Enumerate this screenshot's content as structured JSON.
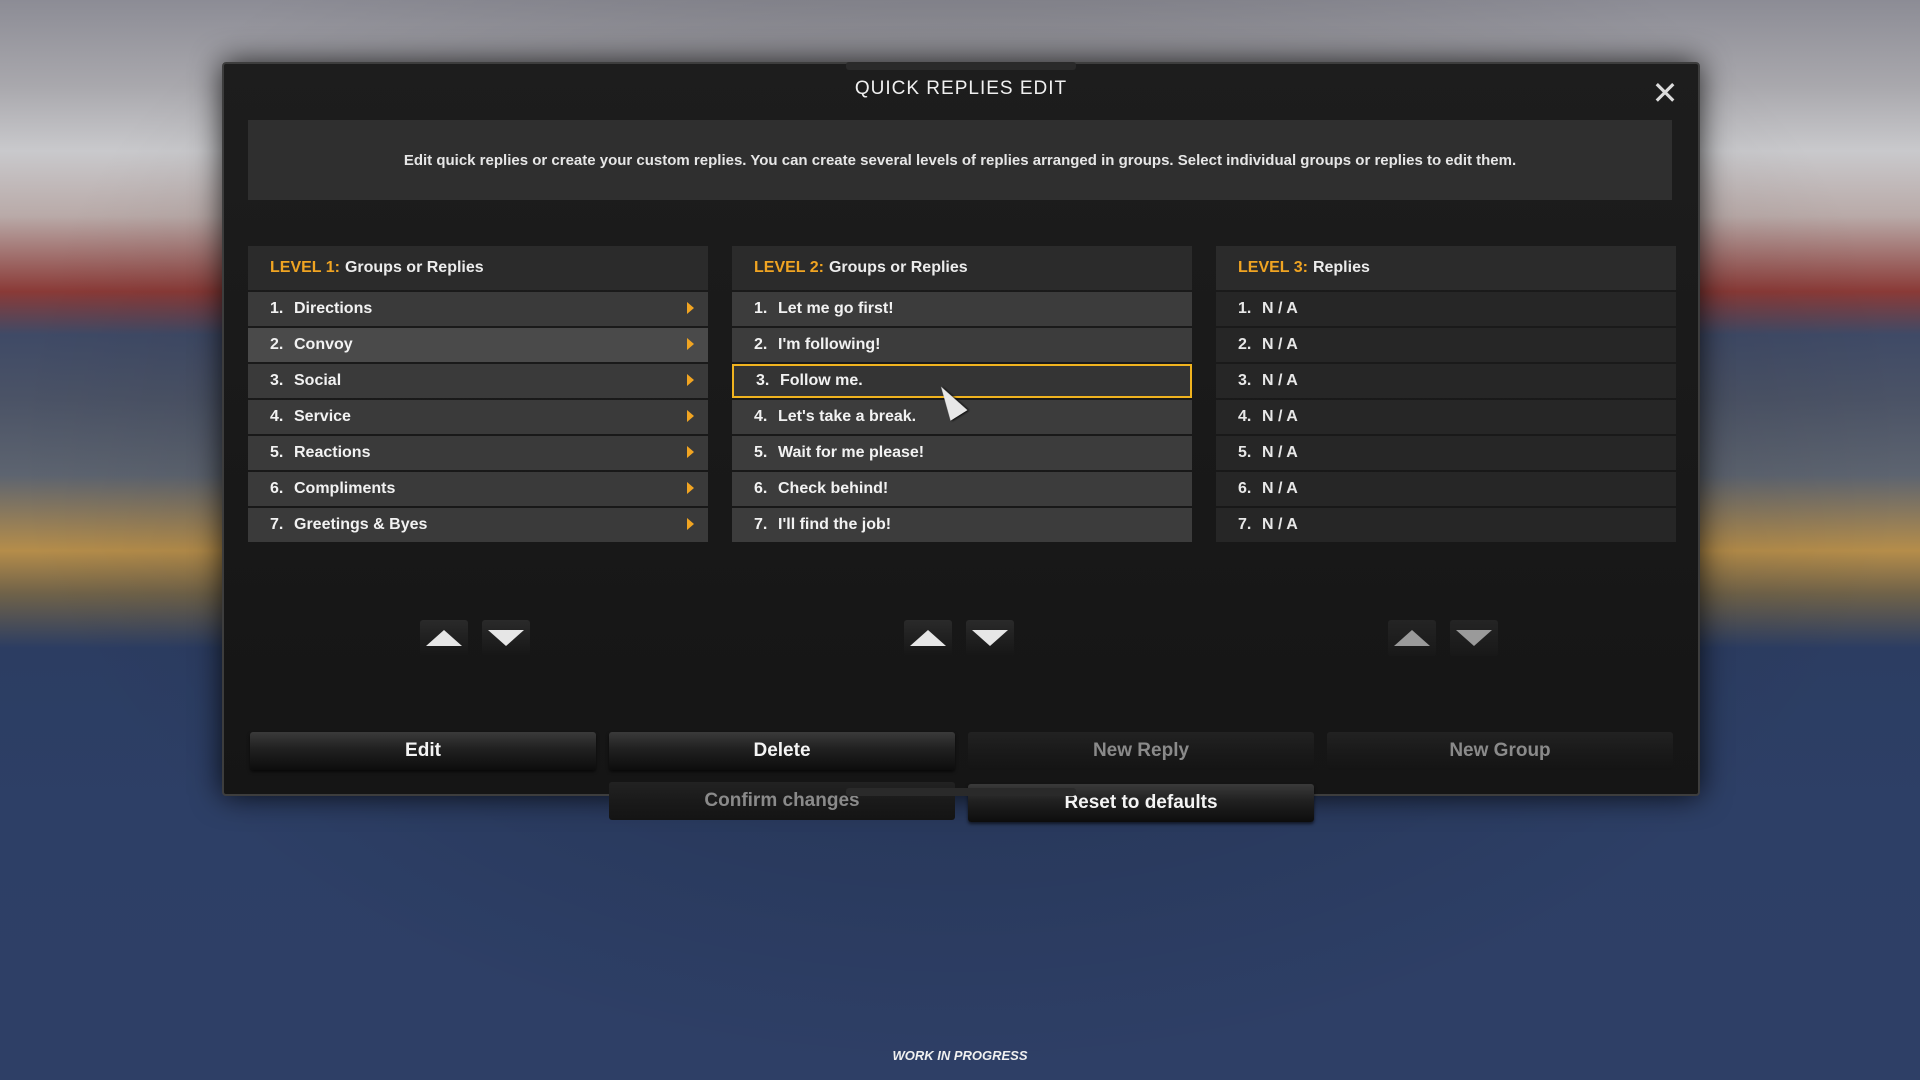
{
  "dialog": {
    "title": "QUICK REPLIES EDIT",
    "close_icon": "close-icon",
    "info": "Edit quick replies or create your custom replies. You can create several levels of replies arranged in groups. Select individual groups or replies to edit them."
  },
  "level1": {
    "prefix": "LEVEL 1:",
    "title": "Groups or Replies",
    "items": [
      {
        "num": "1.",
        "label": "Directions"
      },
      {
        "num": "2.",
        "label": "Convoy"
      },
      {
        "num": "3.",
        "label": "Social"
      },
      {
        "num": "4.",
        "label": "Service"
      },
      {
        "num": "5.",
        "label": "Reactions"
      },
      {
        "num": "6.",
        "label": "Compliments"
      },
      {
        "num": "7.",
        "label": "Greetings & Byes"
      }
    ],
    "selected_index": 1
  },
  "level2": {
    "prefix": "LEVEL 2:",
    "title": "Groups or Replies",
    "items": [
      {
        "num": "1.",
        "label": "Let me go first!"
      },
      {
        "num": "2.",
        "label": "I'm following!"
      },
      {
        "num": "3.",
        "label": "Follow me."
      },
      {
        "num": "4.",
        "label": "Let's take a break."
      },
      {
        "num": "5.",
        "label": "Wait for me please!"
      },
      {
        "num": "6.",
        "label": "Check behind!"
      },
      {
        "num": "7.",
        "label": "I'll find the job!"
      }
    ],
    "selected_index": 2
  },
  "level3": {
    "prefix": "LEVEL 3:",
    "title": "Replies",
    "items": [
      {
        "num": "1.",
        "label": "N / A"
      },
      {
        "num": "2.",
        "label": "N / A"
      },
      {
        "num": "3.",
        "label": "N / A"
      },
      {
        "num": "4.",
        "label": "N / A"
      },
      {
        "num": "5.",
        "label": "N / A"
      },
      {
        "num": "6.",
        "label": "N / A"
      },
      {
        "num": "7.",
        "label": "N / A"
      }
    ]
  },
  "buttons": {
    "edit": "Edit",
    "delete": "Delete",
    "new_reply": "New Reply",
    "new_group": "New Group",
    "confirm": "Confirm changes",
    "reset": "Reset to defaults"
  },
  "footer": "WORK IN PROGRESS",
  "colors": {
    "accent": "#f0a422",
    "selection_border": "#f0b31f"
  }
}
